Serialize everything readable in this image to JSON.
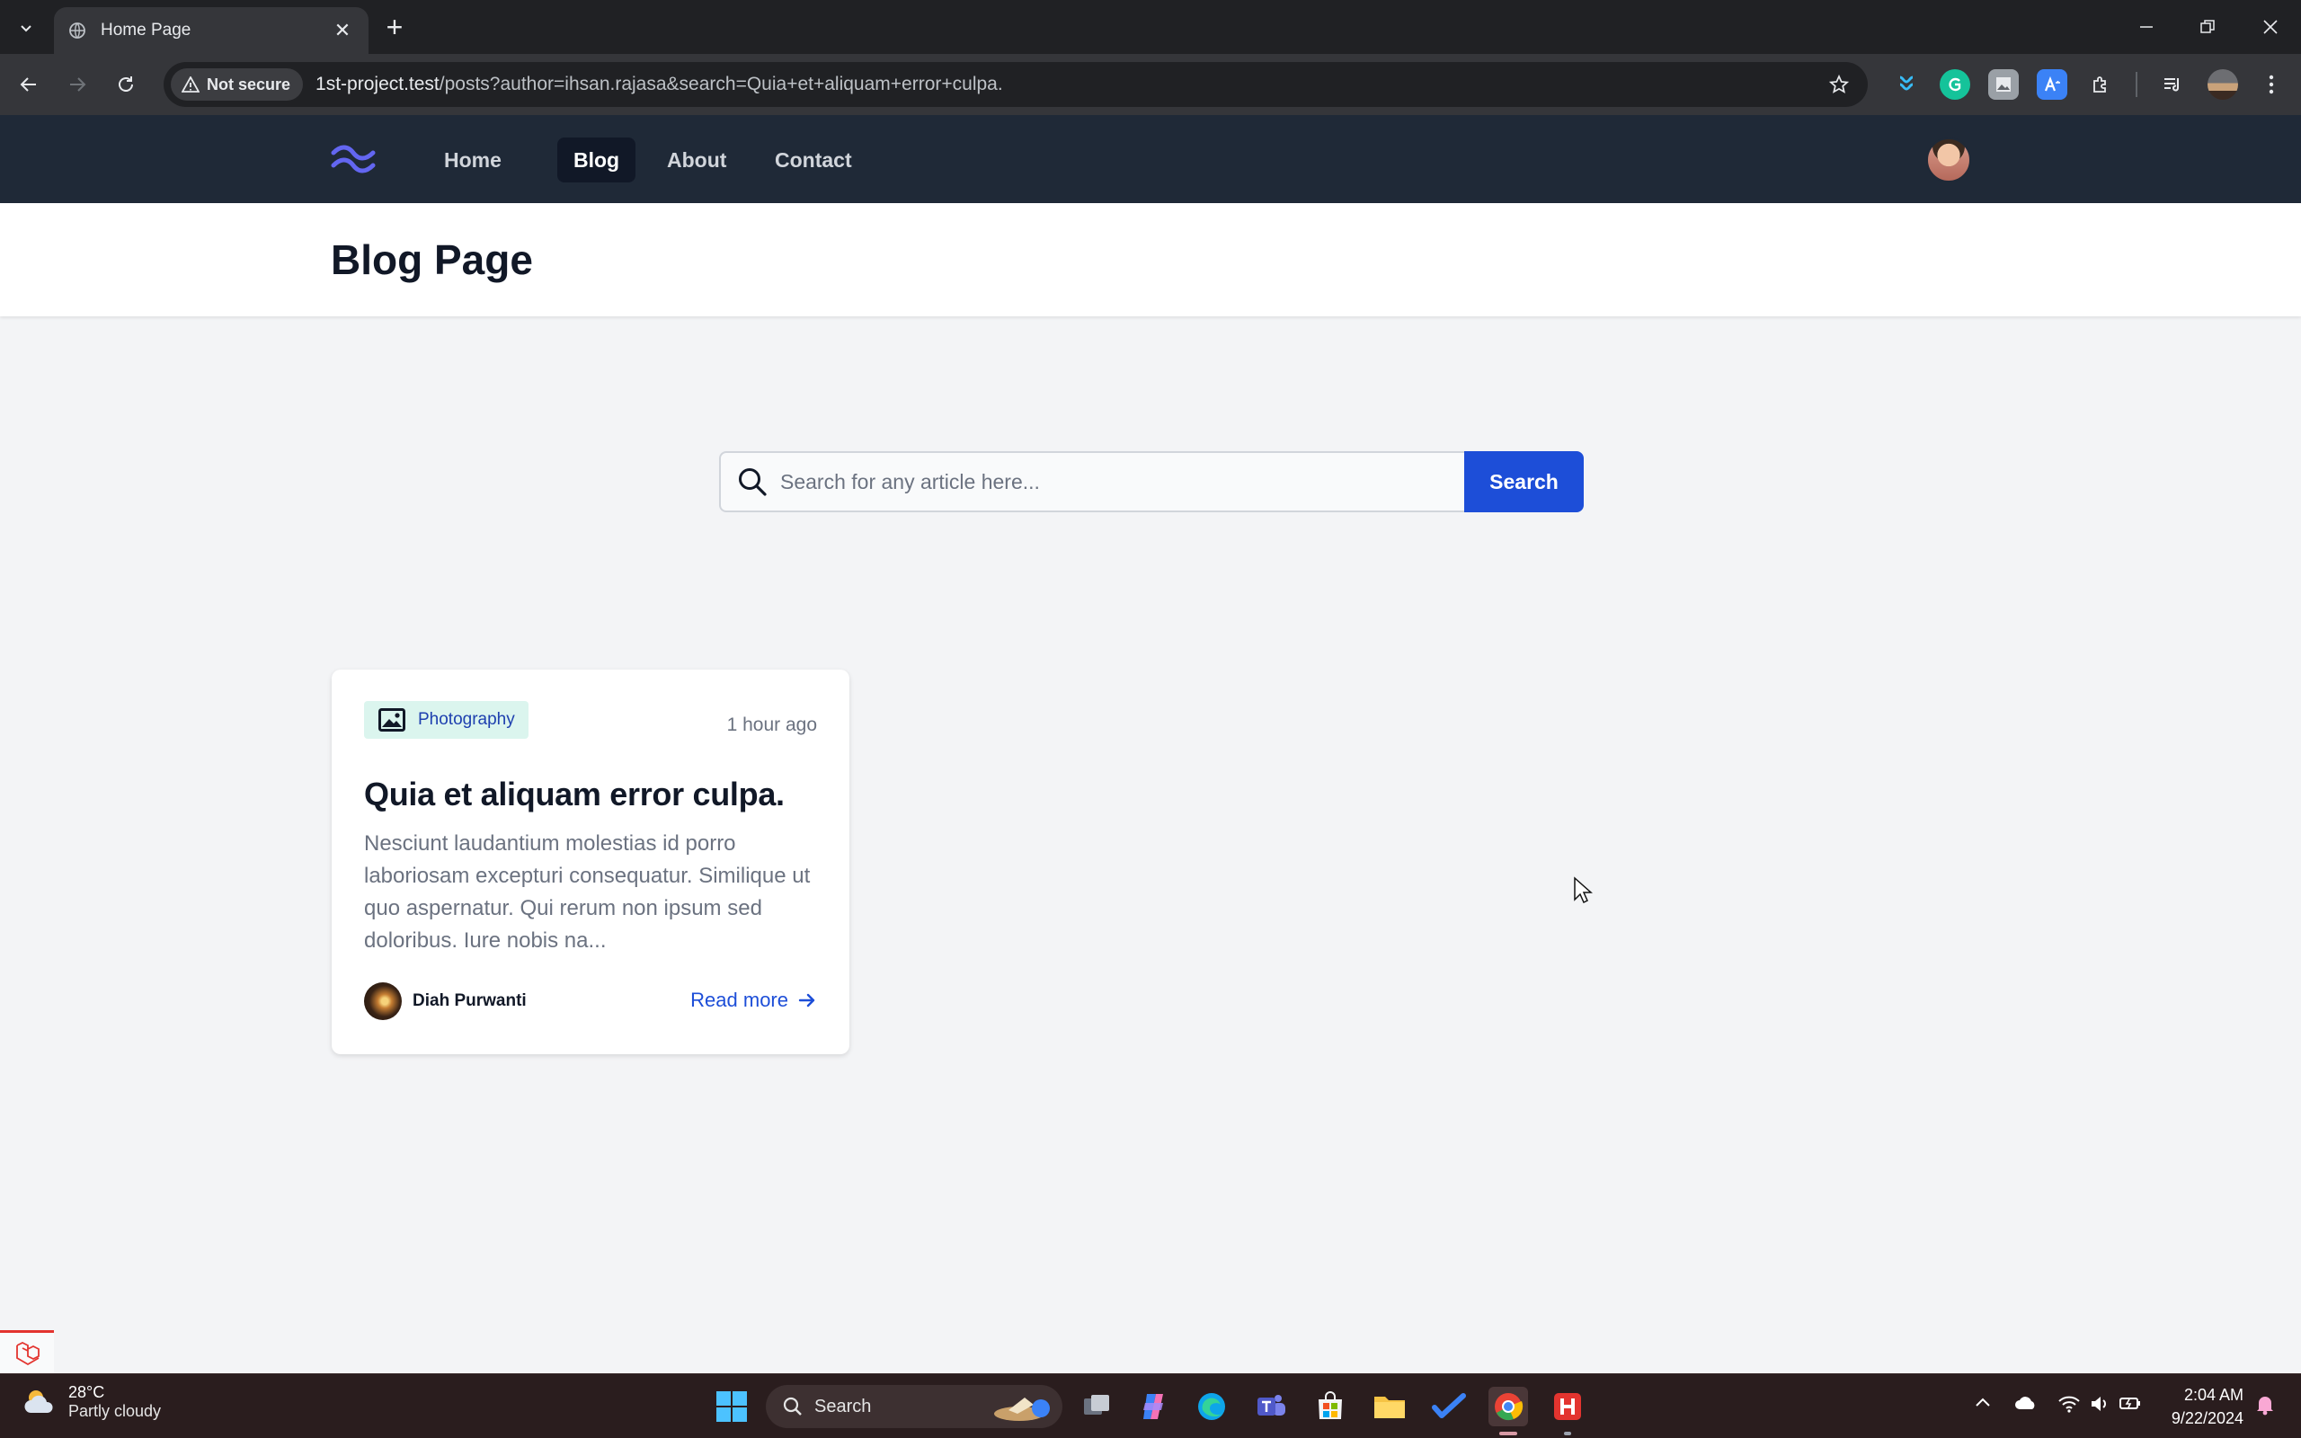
{
  "browser": {
    "tab_title": "Home Page",
    "not_secure_label": "Not secure",
    "url_host": "1st-project.test",
    "url_rest": "/posts?author=ihsan.rajasa&search=Quia+et+aliquam+error+culpa."
  },
  "site_nav": {
    "links": [
      {
        "label": "Home",
        "active": false
      },
      {
        "label": "Blog",
        "active": true
      },
      {
        "label": "About",
        "active": false
      },
      {
        "label": "Contact",
        "active": false
      }
    ]
  },
  "page": {
    "title": "Blog Page"
  },
  "search": {
    "placeholder": "Search for any article here...",
    "button_label": "Search"
  },
  "posts": [
    {
      "category": "Photography",
      "time": "1 hour ago",
      "title": "Quia et aliquam error culpa.",
      "excerpt": "Nesciunt laudantium molestias id porro laboriosam excepturi consequatur. Similique ut quo aspernatur. Qui rerum non ipsum sed doloribus. Iure nobis na...",
      "author": "Diah Purwanti",
      "read_more": "Read more"
    }
  ],
  "taskbar": {
    "weather_temp": "28°C",
    "weather_desc": "Partly cloudy",
    "search_label": "Search",
    "time": "2:04 AM",
    "date": "9/22/2024"
  },
  "colors": {
    "brand_blue": "#1d4ed8",
    "nav_bg": "#1f2937",
    "badge_bg": "#dbf5ee"
  }
}
